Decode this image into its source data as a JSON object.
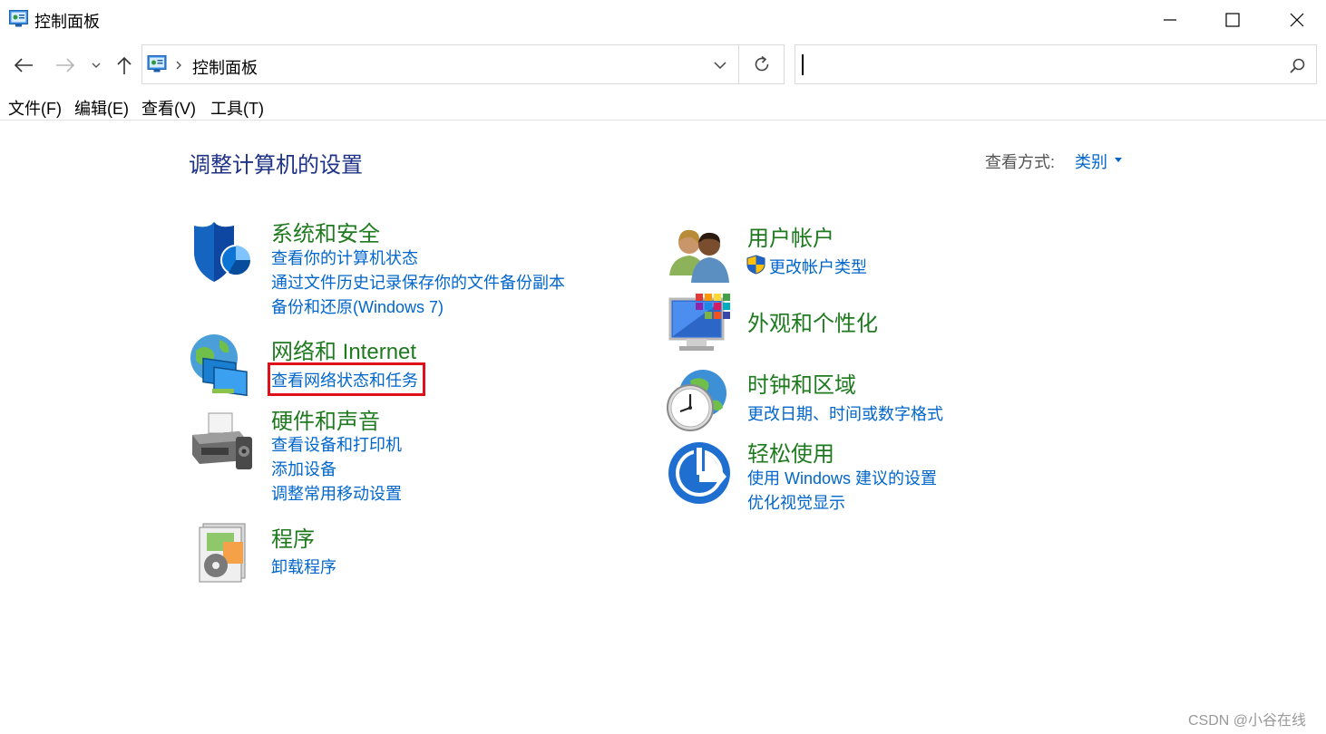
{
  "window": {
    "title": "控制面板"
  },
  "address": {
    "path": "控制面板",
    "search_placeholder": ""
  },
  "menu": [
    "文件(F)",
    "编辑(E)",
    "查看(V)",
    "工具(T)"
  ],
  "main": {
    "title": "调整计算机的设置",
    "view_by_label": "查看方式:",
    "view_by_value": "类别"
  },
  "categories": {
    "system": {
      "title": "系统和安全",
      "links": [
        "查看你的计算机状态",
        "通过文件历史记录保存你的文件备份副本",
        "备份和还原(Windows 7)"
      ]
    },
    "network": {
      "title": "网络和 Internet",
      "links": [
        "查看网络状态和任务"
      ]
    },
    "hardware": {
      "title": "硬件和声音",
      "links": [
        "查看设备和打印机",
        "添加设备",
        "调整常用移动设置"
      ]
    },
    "programs": {
      "title": "程序",
      "links": [
        "卸载程序"
      ]
    },
    "users": {
      "title": "用户帐户",
      "links": [
        "更改帐户类型"
      ]
    },
    "appearance": {
      "title": "外观和个性化",
      "links": []
    },
    "clock": {
      "title": "时钟和区域",
      "links": [
        "更改日期、时间或数字格式"
      ]
    },
    "ease": {
      "title": "轻松使用",
      "links": [
        "使用 Windows 建议的设置",
        "优化视觉显示"
      ]
    }
  },
  "watermark": "CSDN @小谷在线",
  "colors": {
    "category_title": "#1f7a1f",
    "link": "#0066cc",
    "page_title": "#1e3287",
    "highlight": "#e0101a"
  }
}
